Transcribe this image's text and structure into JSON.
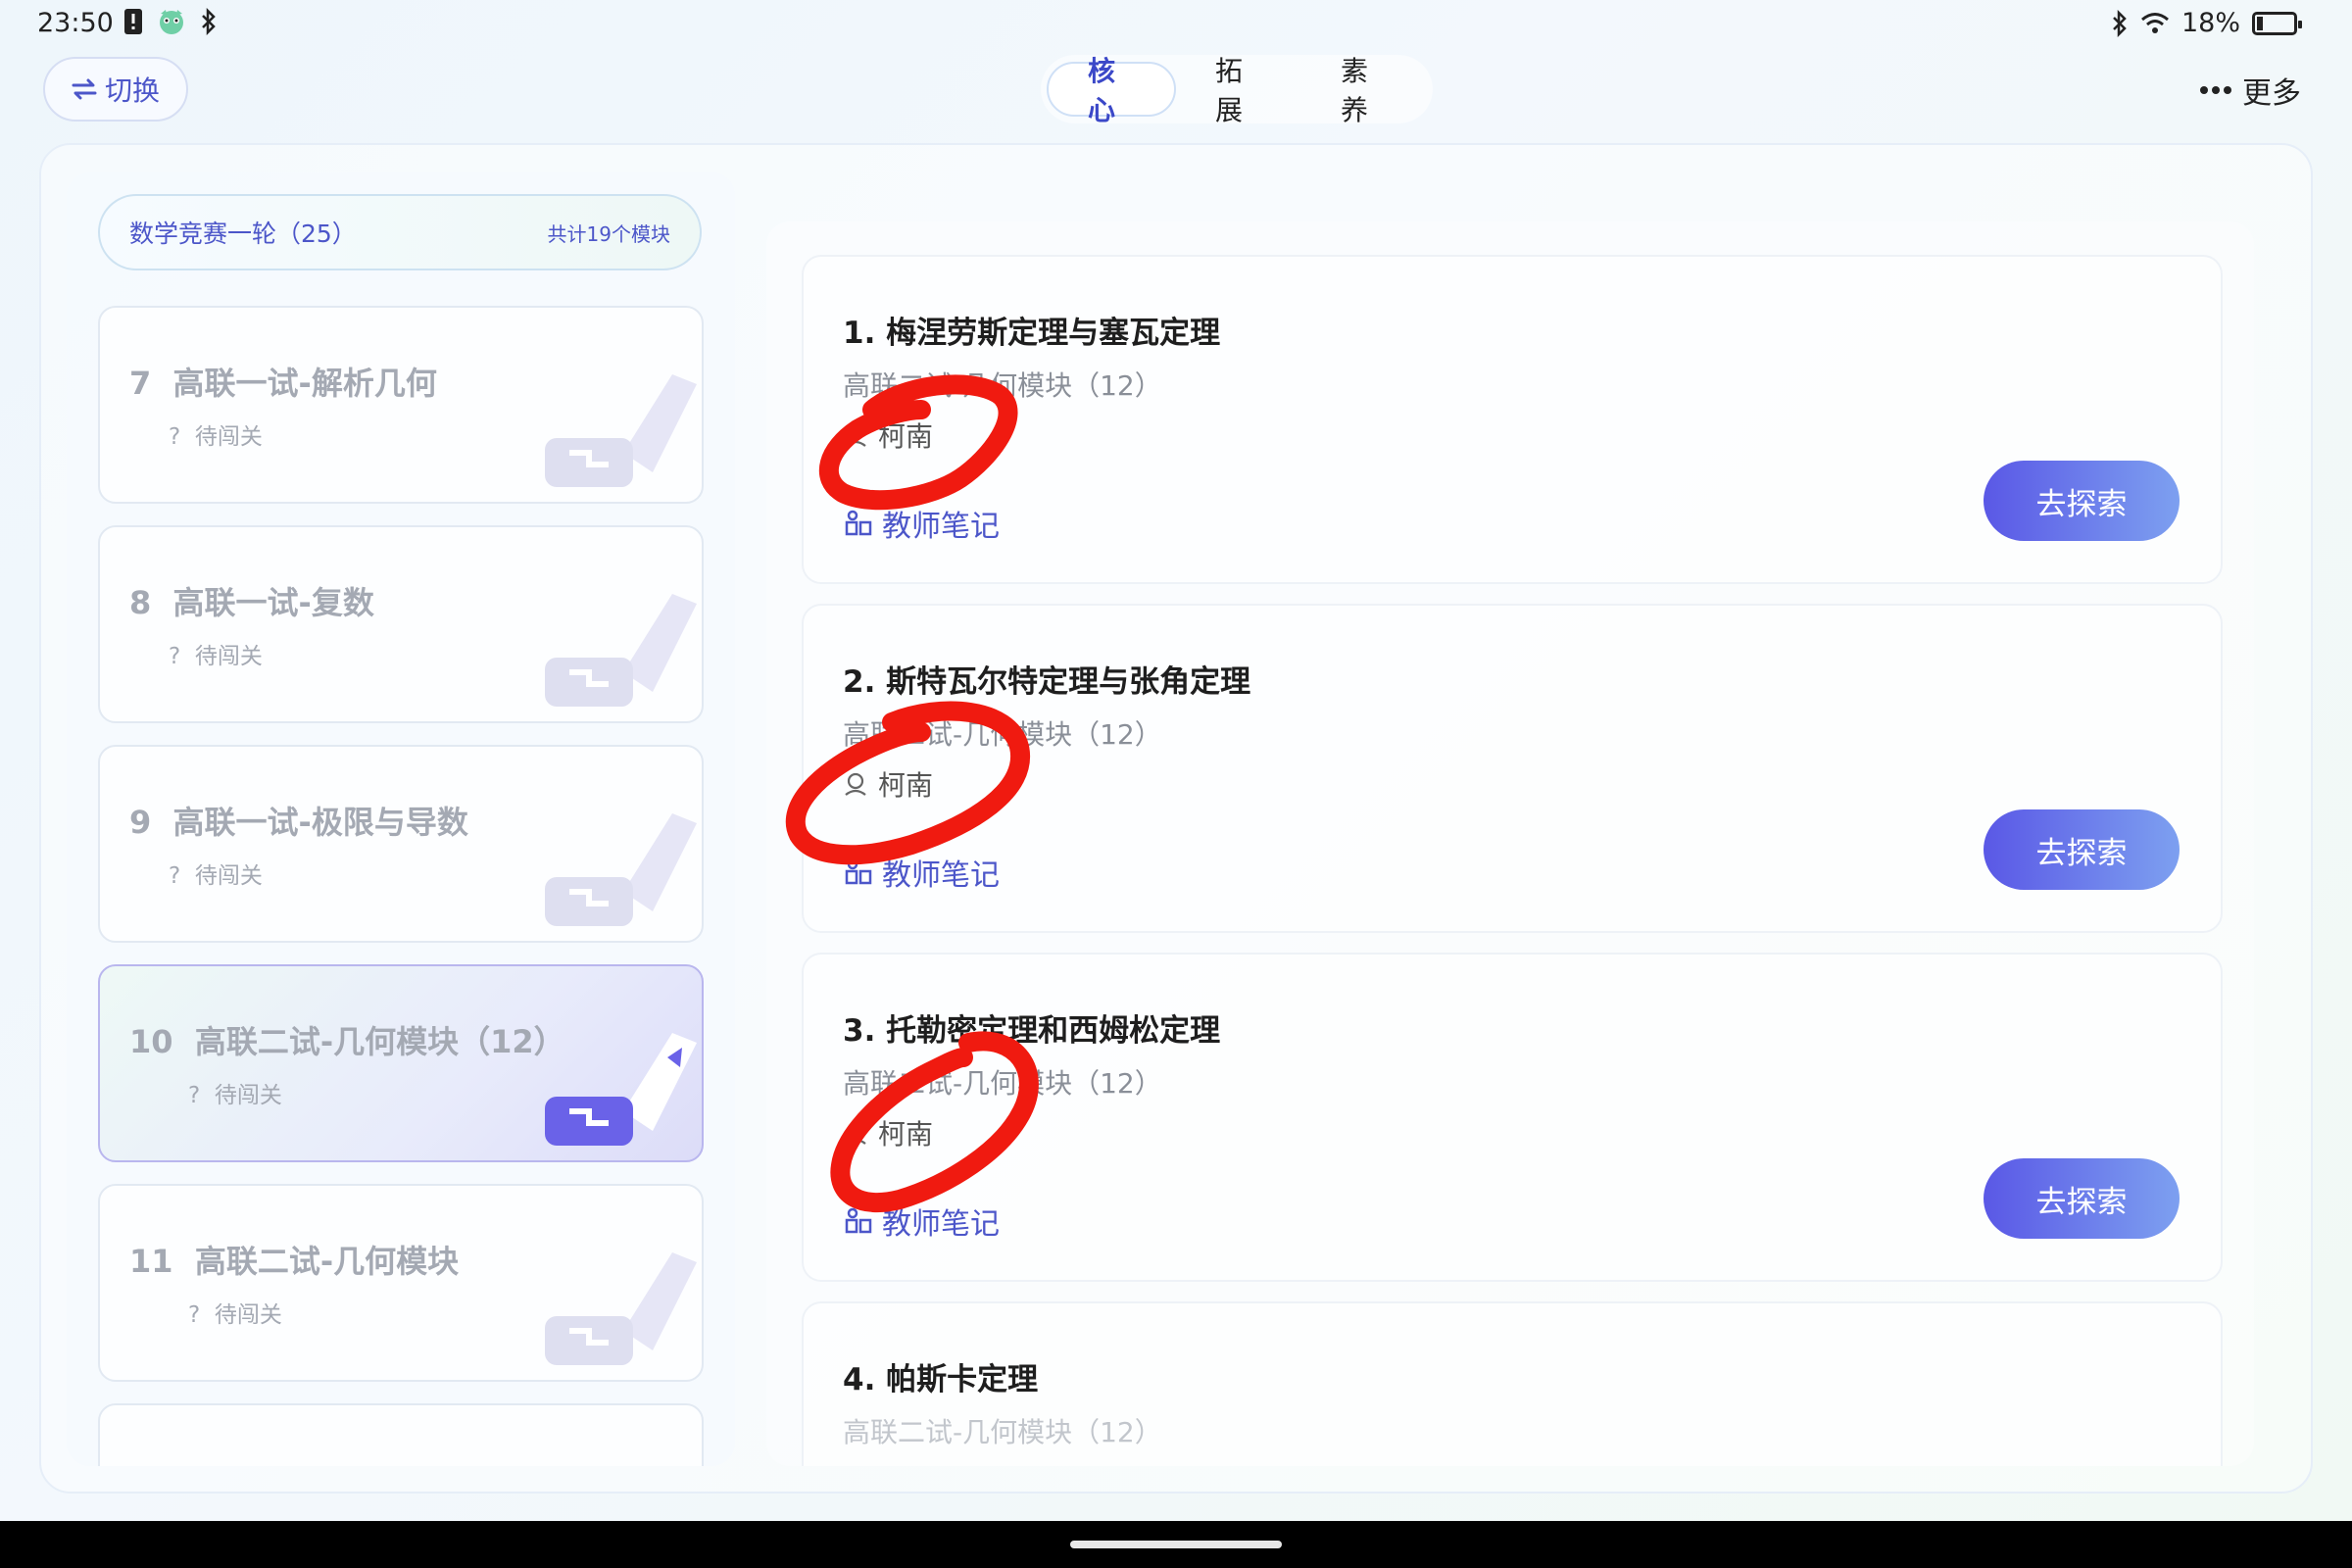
{
  "status_bar": {
    "time": "23:50",
    "battery": "18%",
    "battery_level": 0.18,
    "icons": [
      "sim-alert-icon",
      "app-icon",
      "bluetooth-icon",
      "wifi-icon"
    ]
  },
  "header": {
    "switch_label": "切换",
    "tabs": [
      {
        "label": "核心",
        "active": true
      },
      {
        "label": "拓展",
        "active": false
      },
      {
        "label": "素养",
        "active": false
      }
    ],
    "more_label": "更多"
  },
  "sidebar": {
    "course_name": "数学竞赛一轮（25）",
    "module_count": "共计19个模块",
    "modules": [
      {
        "num": "7",
        "title": "高联一试-解析几何",
        "status": "待闯关",
        "active": false
      },
      {
        "num": "8",
        "title": "高联一试-复数",
        "status": "待闯关",
        "active": false
      },
      {
        "num": "9",
        "title": "高联一试-极限与导数",
        "status": "待闯关",
        "active": false
      },
      {
        "num": "10",
        "title": "高联二试-几何模块（12）",
        "status": "待闯关",
        "active": true
      },
      {
        "num": "11",
        "title": "高联二试-几何模块",
        "status": "待闯关",
        "active": false
      }
    ]
  },
  "lessons": [
    {
      "title": "1. 梅涅劳斯定理与塞瓦定理",
      "subtitle": "高联二试-几何模块（12）",
      "author": "柯南",
      "notes": "教师笔记",
      "button": "去探索"
    },
    {
      "title": "2. 斯特瓦尔特定理与张角定理",
      "subtitle": "高联二试-几何模块（12）",
      "author": "柯南",
      "notes": "教师笔记",
      "button": "去探索"
    },
    {
      "title": "3. 托勒密定理和西姆松定理",
      "subtitle": "高联二试-几何模块（12）",
      "author": "柯南",
      "notes": "教师笔记",
      "button": "去探索"
    },
    {
      "title": "4. 帕斯卡定理",
      "subtitle": "高联二试-几何模块（12）"
    }
  ],
  "colors": {
    "accent": "#4c56c9",
    "button_start": "#5a58e6",
    "button_end": "#7da0f0",
    "scribble": "#f01a10"
  }
}
